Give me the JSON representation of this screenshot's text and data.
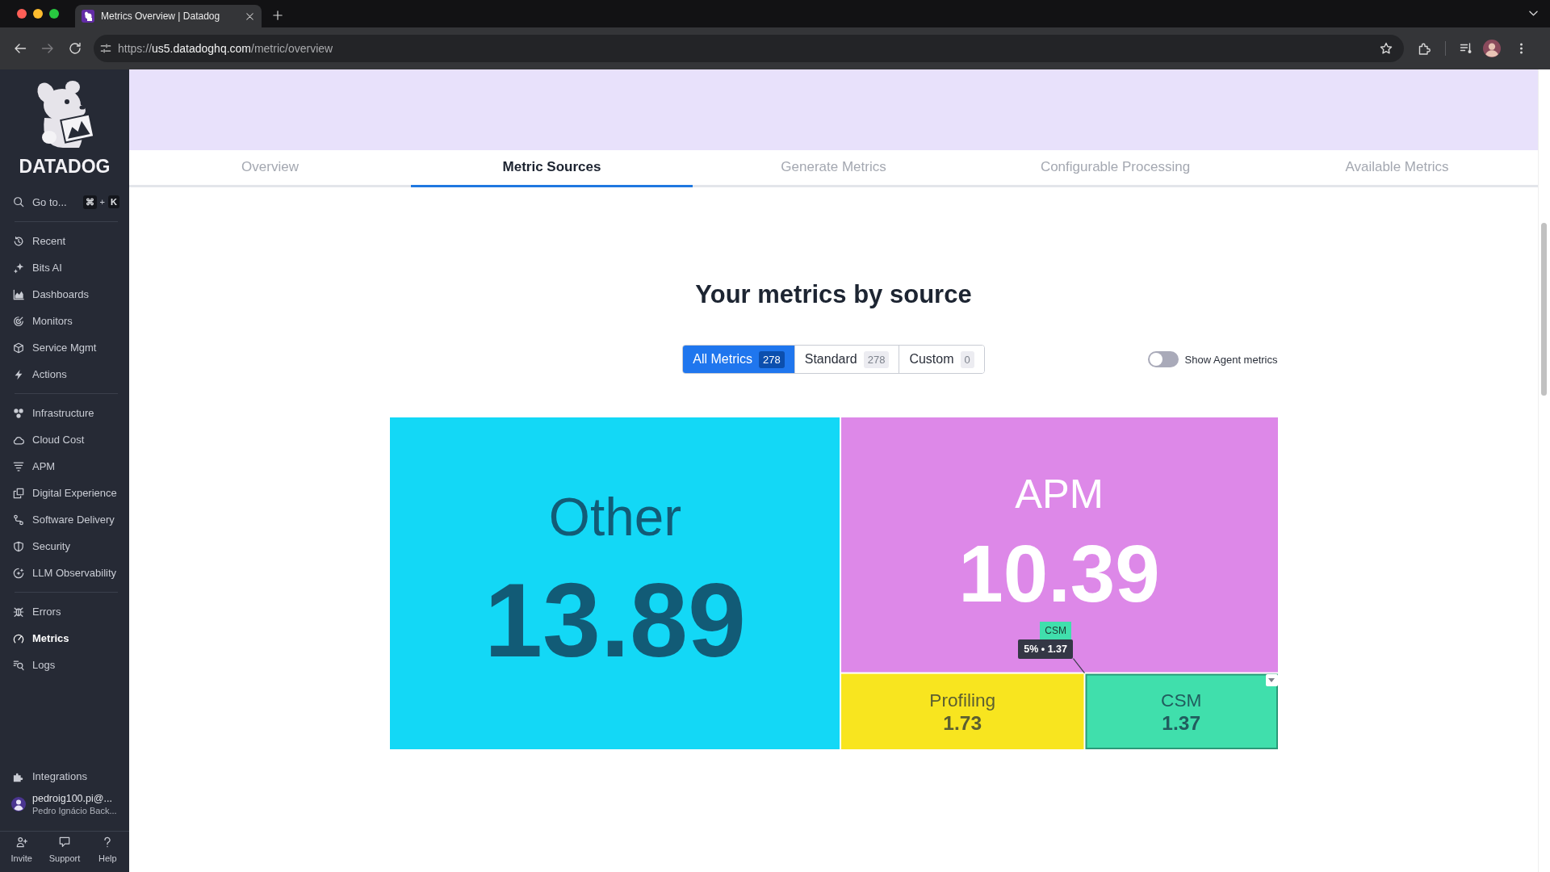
{
  "browser": {
    "tab_title": "Metrics Overview | Datadog",
    "url": {
      "scheme": "https://",
      "host": "us5.datadoghq.com",
      "path": "/metric/overview"
    }
  },
  "sidebar": {
    "logo": "DATADOG",
    "search": {
      "label": "Go to...",
      "shortcut": [
        {
          "kind": "key",
          "text": "⌘"
        },
        {
          "kind": "plus",
          "text": "+"
        },
        {
          "kind": "key",
          "text": "K"
        }
      ]
    },
    "groups": [
      {
        "items": [
          {
            "label": "Recent",
            "selected": false
          },
          {
            "label": "Bits AI",
            "selected": false
          },
          {
            "label": "Dashboards",
            "selected": false
          },
          {
            "label": "Monitors",
            "selected": false
          },
          {
            "label": "Service Mgmt",
            "selected": false
          },
          {
            "label": "Actions",
            "selected": false
          }
        ]
      },
      {
        "items": [
          {
            "label": "Infrastructure",
            "selected": false
          },
          {
            "label": "Cloud Cost",
            "selected": false
          },
          {
            "label": "APM",
            "selected": false
          },
          {
            "label": "Digital Experience",
            "selected": false
          },
          {
            "label": "Software Delivery",
            "selected": false
          },
          {
            "label": "Security",
            "selected": false
          },
          {
            "label": "LLM Observability",
            "selected": false
          }
        ]
      },
      {
        "items": [
          {
            "label": "Errors",
            "selected": false
          },
          {
            "label": "Metrics",
            "selected": true
          },
          {
            "label": "Logs",
            "selected": false
          }
        ]
      }
    ],
    "integrations": {
      "label": "Integrations",
      "selected": false
    },
    "user": {
      "email": "pedroig100.pi@...",
      "name": "Pedro Ignácio Back..."
    },
    "footer": [
      "Invite",
      "Support",
      "Help"
    ]
  },
  "tabs": [
    {
      "label": "Overview",
      "selected": false
    },
    {
      "label": "Metric Sources",
      "selected": true
    },
    {
      "label": "Generate Metrics",
      "selected": false
    },
    {
      "label": "Configurable Processing",
      "selected": false
    },
    {
      "label": "Available Metrics",
      "selected": false
    }
  ],
  "title": "Your metrics by source",
  "filters": [
    {
      "label": "All Metrics",
      "count": "278",
      "selected": true
    },
    {
      "label": "Standard",
      "count": "278",
      "selected": false
    },
    {
      "label": "Custom",
      "count": "0",
      "selected": false
    }
  ],
  "agent_toggle": {
    "label": "Show Agent metrics",
    "on": false
  },
  "treemap": {
    "chart_data": {
      "type": "other",
      "categories": [
        "Other",
        "APM",
        "Profiling",
        "CSM"
      ],
      "values": [
        13.89,
        10.39,
        1.73,
        1.37
      ],
      "colors": [
        "#13d8f6",
        "#dd88e8",
        "#f8e51f",
        "#40dfac"
      ],
      "data_labels": true
    },
    "hover": {
      "label": "CSM",
      "text": "5% • 1.37"
    }
  }
}
